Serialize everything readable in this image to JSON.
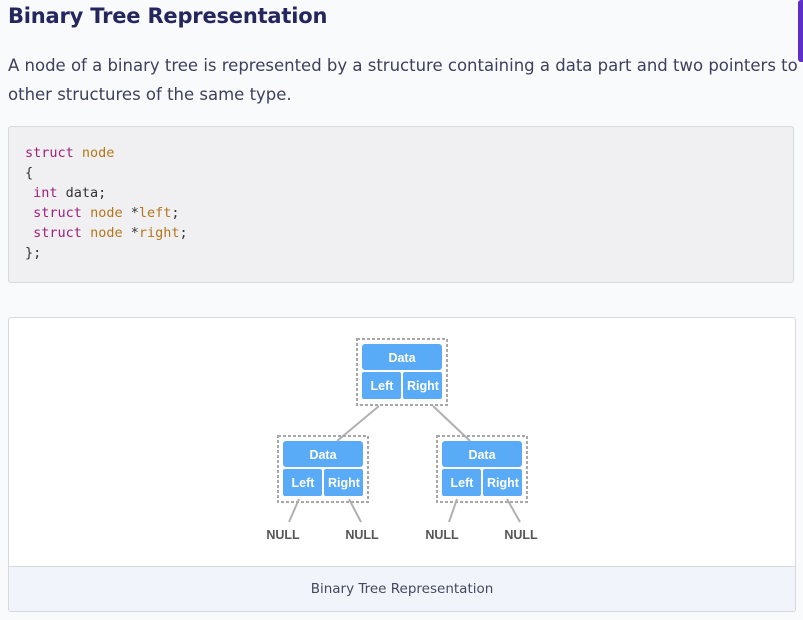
{
  "heading": "Binary Tree Representation",
  "intro": "A node of a binary tree is represented by a structure containing a data part and two pointers to other structures of the same type.",
  "code": {
    "line1_kw": "struct",
    "line1_type": "node",
    "line2": "{",
    "line3_kw": "int",
    "line3_rest": " data;",
    "line4_kw": "struct",
    "line4_type": "node",
    "line4_rest": " *",
    "line4_field": "left",
    "line4_end": ";",
    "line5_kw": "struct",
    "line5_type": "node",
    "line5_rest": " *",
    "line5_field": "right",
    "line5_end": ";",
    "line6": "};"
  },
  "diagram": {
    "node_data_label": "Data",
    "node_left_label": "Left",
    "node_right_label": "Right",
    "null_label": "NULL",
    "node_color": "#5aabf7",
    "edge_color": "#b0b0b0"
  },
  "caption": "Binary Tree Representation"
}
